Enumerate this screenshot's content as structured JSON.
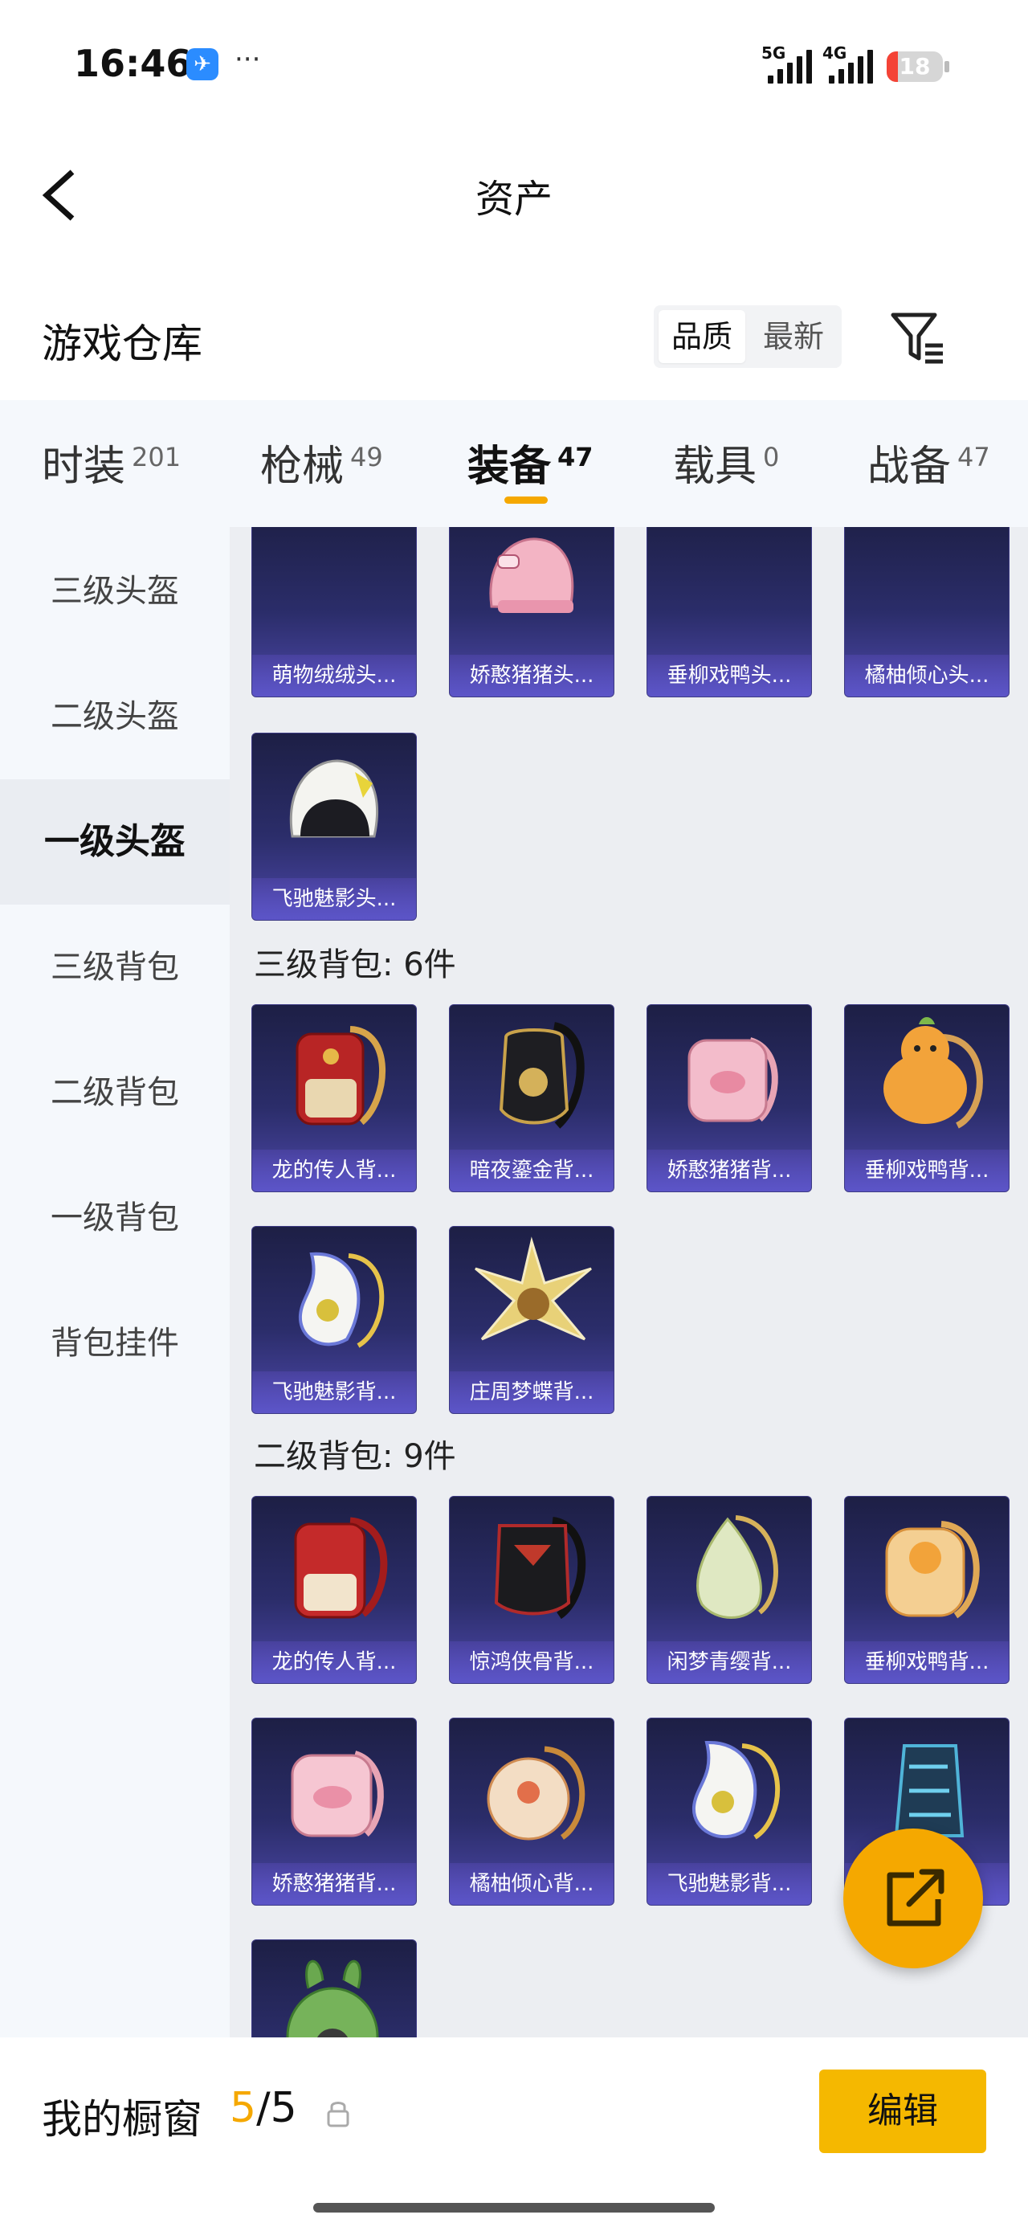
{
  "status_bar": {
    "time": "16:46",
    "app_badge_icon": "messenger-icon",
    "more": "···",
    "net1": "5G",
    "net2": "4G",
    "battery": "18"
  },
  "nav": {
    "title": "资产",
    "back_icon": "chevron-left-icon"
  },
  "section": {
    "title": "游戏仓库",
    "sort_options": [
      "品质",
      "最新"
    ],
    "selected_sort": "品质",
    "filter_icon": "filter-icon"
  },
  "tabs": [
    {
      "label": "时装",
      "count": "201"
    },
    {
      "label": "枪械",
      "count": "49"
    },
    {
      "label": "装备",
      "count": "47"
    },
    {
      "label": "载具",
      "count": "0"
    },
    {
      "label": "战备",
      "count": "47"
    }
  ],
  "active_tab": "装备",
  "sidebar": [
    {
      "label": "三级头盔"
    },
    {
      "label": "二级头盔"
    },
    {
      "label": "一级头盔"
    },
    {
      "label": "三级背包"
    },
    {
      "label": "二级背包"
    },
    {
      "label": "一级背包"
    },
    {
      "label": "背包挂件"
    }
  ],
  "active_sidebar": "一级头盔",
  "groups": [
    {
      "header": "",
      "items": [
        "萌物绒绒头...",
        "娇憨猪猪头...",
        "垂柳戏鸭头...",
        "橘柚倾心头...",
        "飞驰魅影头..."
      ]
    },
    {
      "header": "三级背包: 6件",
      "items": [
        "龙的传人背...",
        "暗夜鎏金背...",
        "娇憨猪猪背...",
        "垂柳戏鸭背...",
        "飞驰魅影背...",
        "庄周梦蝶背..."
      ]
    },
    {
      "header": "二级背包: 9件",
      "items": [
        "龙的传人背...",
        "惊鸿侠骨背...",
        "闲梦青缨背...",
        "垂柳戏鸭背...",
        "娇憨猪猪背...",
        "橘柚倾心背...",
        "飞驰魅影背...",
        "",
        ""
      ]
    }
  ],
  "bottom": {
    "label": "我的橱窗",
    "count_current": "5",
    "count_sep": "/",
    "count_total": "5",
    "lock_icon": "lock-icon",
    "edit_label": "编辑"
  },
  "fab": {
    "icon": "share-icon"
  },
  "colors": {
    "accent": "#f5a800",
    "card_top": "#1d1f45",
    "card_bottom": "#4c47a8",
    "tab_bg": "#f5f8fc"
  }
}
